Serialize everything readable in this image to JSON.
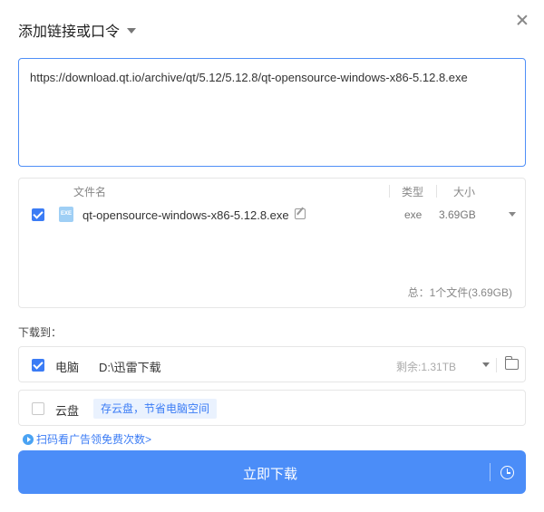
{
  "dialog": {
    "title": "添加链接或口令"
  },
  "url_input": {
    "value": "https://download.qt.io/archive/qt/5.12/5.12.8/qt-opensource-windows-x86-5.12.8.exe"
  },
  "file_list": {
    "headers": {
      "name": "文件名",
      "type": "类型",
      "size": "大小"
    },
    "files": [
      {
        "checked": true,
        "icon_label": "EXE",
        "name": "qt-opensource-windows-x86-5.12.8.exe",
        "type": "exe",
        "size": "3.69GB"
      }
    ],
    "summary": "总：1个文件(3.69GB)"
  },
  "download_to": {
    "label": "下载到：",
    "computer": {
      "checked": true,
      "name": "电脑",
      "path": "D:\\迅雷下载",
      "remaining": "剩余:1.31TB"
    },
    "cloud": {
      "checked": false,
      "name": "云盘",
      "tag": "存云盘，节省电脑空间"
    }
  },
  "promo": {
    "text": "扫码看广告领免费次数>"
  },
  "download_button": {
    "label": "立即下载"
  },
  "colors": {
    "accent": "#4b8df8",
    "checkbox": "#3b7cf5",
    "link": "#3b7cf5"
  }
}
